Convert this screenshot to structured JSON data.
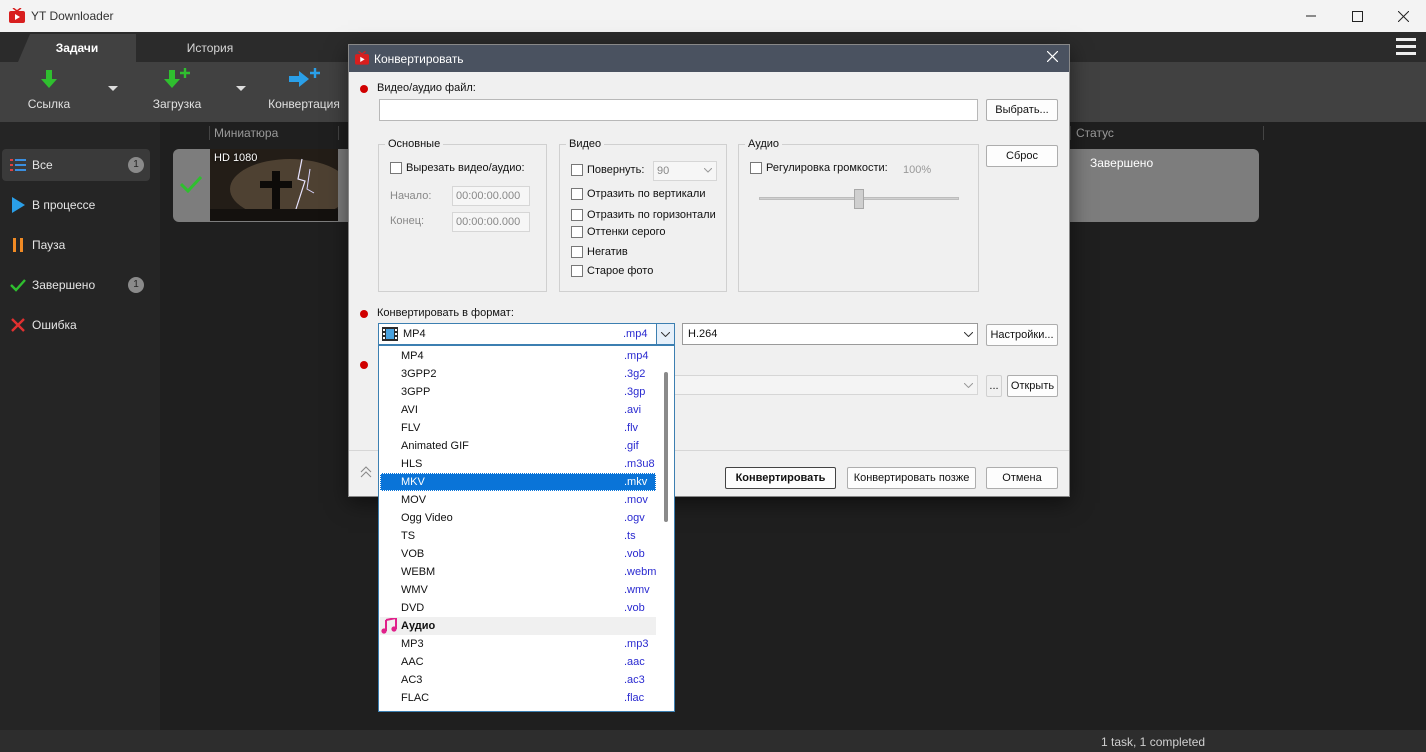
{
  "window": {
    "title": "YT Downloader",
    "controls": [
      "minimize",
      "maximize",
      "close"
    ]
  },
  "tabs": [
    {
      "label": "Задачи",
      "active": true
    },
    {
      "label": "История",
      "active": false
    }
  ],
  "toolbar": {
    "link_label": "Ссылка",
    "download_label": "Загрузка",
    "convert_label": "Конвертация"
  },
  "sidebar": {
    "items": [
      {
        "label": "Все",
        "badge": "1",
        "icon": "list-icon",
        "active": true
      },
      {
        "label": "В процессе",
        "badge": "",
        "icon": "play-icon"
      },
      {
        "label": "Пауза",
        "badge": "",
        "icon": "pause-icon"
      },
      {
        "label": "Завершено",
        "badge": "1",
        "icon": "check-icon"
      },
      {
        "label": "Ошибка",
        "badge": "",
        "icon": "x-icon"
      }
    ]
  },
  "table": {
    "headers": {
      "thumbnail": "Миниатюра",
      "status": "Статус"
    },
    "row": {
      "quality": "HD 1080",
      "status": "Завершено"
    }
  },
  "statusbar": {
    "text": "1 task, 1 completed"
  },
  "dialog": {
    "title": "Конвертировать",
    "file_label": "Видео/аудио файл:",
    "file_value": "",
    "choose_button": "Выбрать...",
    "reset_button": "Сброс",
    "basic": {
      "title": "Основные",
      "cut_label": "Вырезать видео/аудио:",
      "start_label": "Начало:",
      "start_value": "00:00:00.000",
      "end_label": "Конец:",
      "end_value": "00:00:00.000"
    },
    "video": {
      "title": "Видео",
      "rotate_label": "Повернуть:",
      "rotate_value": "90",
      "flip_v": "Отразить по вертикали",
      "flip_h": "Отразить по горизонтали",
      "grayscale": "Оттенки серого",
      "negative": "Негатив",
      "old_photo": "Старое фото"
    },
    "audio": {
      "title": "Аудио",
      "volume_label": "Регулировка громкости:",
      "volume_value": "100%",
      "volume_level": 0.5
    },
    "format_label": "Конвертировать в формат:",
    "format_selected": {
      "name": "MP4",
      "ext": ".mp4"
    },
    "codec_value": "H.264",
    "settings_button": "Настройки...",
    "output_browse": "...",
    "open_button": "Открыть",
    "convert_button": "Конвертировать",
    "convert_later_button": "Конвертировать позже",
    "cancel_button": "Отмена"
  },
  "dropdown": {
    "items": [
      {
        "name": "MP4",
        "ext": ".mp4"
      },
      {
        "name": "3GPP2",
        "ext": ".3g2"
      },
      {
        "name": "3GPP",
        "ext": ".3gp"
      },
      {
        "name": "AVI",
        "ext": ".avi"
      },
      {
        "name": "FLV",
        "ext": ".flv"
      },
      {
        "name": "Animated GIF",
        "ext": ".gif"
      },
      {
        "name": "HLS",
        "ext": ".m3u8"
      },
      {
        "name": "MKV",
        "ext": ".mkv",
        "selected": true
      },
      {
        "name": "MOV",
        "ext": ".mov"
      },
      {
        "name": "Ogg Video",
        "ext": ".ogv"
      },
      {
        "name": "TS",
        "ext": ".ts"
      },
      {
        "name": "VOB",
        "ext": ".vob"
      },
      {
        "name": "WEBM",
        "ext": ".webm"
      },
      {
        "name": "WMV",
        "ext": ".wmv"
      },
      {
        "name": "DVD",
        "ext": ".vob"
      },
      {
        "name": "Аудио",
        "ext": "",
        "header": true
      },
      {
        "name": "MP3",
        "ext": ".mp3"
      },
      {
        "name": "AAC",
        "ext": ".aac"
      },
      {
        "name": "AC3",
        "ext": ".ac3"
      },
      {
        "name": "FLAC",
        "ext": ".flac"
      }
    ]
  }
}
